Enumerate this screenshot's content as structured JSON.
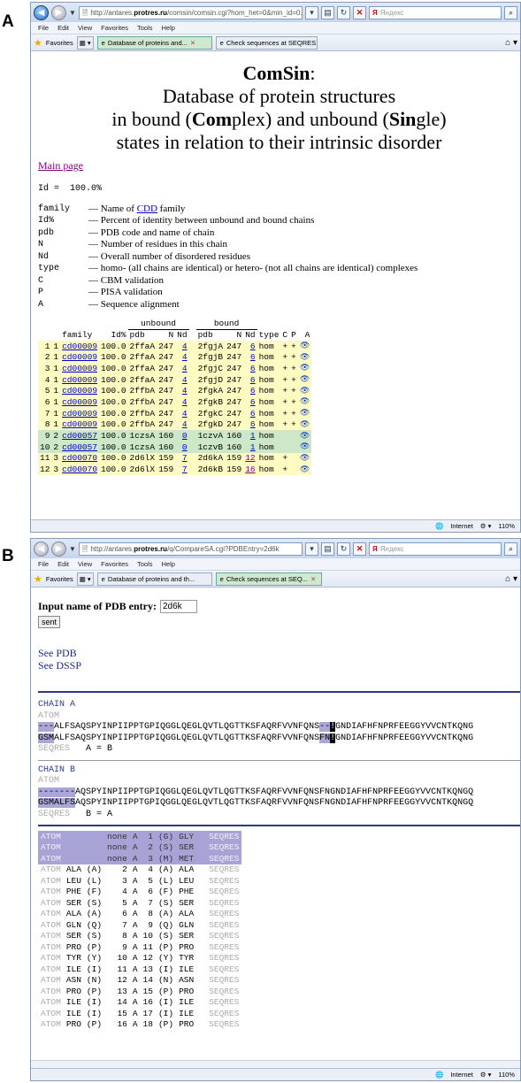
{
  "panelA": {
    "letter": "A",
    "browser": {
      "url_prefix": "http://antares.",
      "url_domain": "protres.ru",
      "url_suffix": "/comsin/comsin.cgi?hom_het=0&min_id=0.9",
      "search_engine": "Яндекс",
      "menu": [
        "File",
        "Edit",
        "View",
        "Favorites",
        "Tools",
        "Help"
      ],
      "favorites_label": "Favorites",
      "tabs": [
        "Database of proteins and...",
        "Check sequences at SEQRES..."
      ],
      "status_zone": "Internet",
      "zoom": "110%"
    },
    "page": {
      "title_word": "ComSin",
      "title_colon": ":",
      "subtitle1": "Database of protein structures",
      "subtitle2_a": "in bound (",
      "subtitle2_com": "Com",
      "subtitle2_b": "plex) and unbound (",
      "subtitle2_sin": "Sin",
      "subtitle2_c": "gle)",
      "subtitle3": "states in relation to their intrinsic disorder",
      "main_page_link": "Main page",
      "id_line": "Id =  100.0%",
      "legend": [
        {
          "key": "family",
          "pre": "— Name of ",
          "link": "CDD",
          "post": " family"
        },
        {
          "key": "Id%",
          "pre": "— Percent of identity between unbound and bound chains",
          "link": "",
          "post": ""
        },
        {
          "key": "pdb",
          "pre": "— PDB code and name of chain",
          "link": "",
          "post": ""
        },
        {
          "key": "N",
          "pre": "— Number of residues in this chain",
          "link": "",
          "post": ""
        },
        {
          "key": "Nd",
          "pre": "— Overall number of disordered residues",
          "link": "",
          "post": ""
        },
        {
          "key": "type",
          "pre": "— homo- (all chains are identical) or hetero- (not all chains are identical) complexes",
          "link": "",
          "post": ""
        },
        {
          "key": "C",
          "pre": "— CBM validation",
          "link": "",
          "post": ""
        },
        {
          "key": "P",
          "pre": "— PISA validation",
          "link": "",
          "post": ""
        },
        {
          "key": "A",
          "pre": "— Sequence alignment",
          "link": "",
          "post": ""
        }
      ],
      "table_group_unbound": "unbound",
      "table_group_bound": "bound",
      "table_headers": [
        "",
        "",
        "family",
        "Id%",
        "pdb",
        "N",
        "Nd",
        "pdb",
        "N",
        "Nd",
        "type",
        "C",
        "P",
        "A"
      ],
      "rows": [
        {
          "n": "1",
          "g": "1",
          "family": "cd00009",
          "id": "100.0",
          "pdb_u": "2ffaA",
          "n_u": "247",
          "nd_u": "4",
          "pdb_b": "2fgjA",
          "n_b": "247",
          "nd_b": "6",
          "type": "hom",
          "c": "+",
          "p": "+",
          "color": "yellow"
        },
        {
          "n": "2",
          "g": "1",
          "family": "cd00009",
          "id": "100.0",
          "pdb_u": "2ffaA",
          "n_u": "247",
          "nd_u": "4",
          "pdb_b": "2fgjB",
          "n_b": "247",
          "nd_b": "6",
          "type": "hom",
          "c": "+",
          "p": "+",
          "color": "yellow"
        },
        {
          "n": "3",
          "g": "1",
          "family": "cd00009",
          "id": "100.0",
          "pdb_u": "2ffaA",
          "n_u": "247",
          "nd_u": "4",
          "pdb_b": "2fgjC",
          "n_b": "247",
          "nd_b": "6",
          "type": "hom",
          "c": "+",
          "p": "+",
          "color": "yellow"
        },
        {
          "n": "4",
          "g": "1",
          "family": "cd00009",
          "id": "100.0",
          "pdb_u": "2ffaA",
          "n_u": "247",
          "nd_u": "4",
          "pdb_b": "2fgjD",
          "n_b": "247",
          "nd_b": "6",
          "type": "hom",
          "c": "+",
          "p": "+",
          "color": "yellow"
        },
        {
          "n": "5",
          "g": "1",
          "family": "cd00009",
          "id": "100.0",
          "pdb_u": "2ffbA",
          "n_u": "247",
          "nd_u": "4",
          "pdb_b": "2fgkA",
          "n_b": "247",
          "nd_b": "6",
          "type": "hom",
          "c": "+",
          "p": "+",
          "color": "yellow"
        },
        {
          "n": "6",
          "g": "1",
          "family": "cd00009",
          "id": "100.0",
          "pdb_u": "2ffbA",
          "n_u": "247",
          "nd_u": "4",
          "pdb_b": "2fgkB",
          "n_b": "247",
          "nd_b": "6",
          "type": "hom",
          "c": "+",
          "p": "+",
          "color": "yellow"
        },
        {
          "n": "7",
          "g": "1",
          "family": "cd00009",
          "id": "100.0",
          "pdb_u": "2ffbA",
          "n_u": "247",
          "nd_u": "4",
          "pdb_b": "2fgkC",
          "n_b": "247",
          "nd_b": "6",
          "type": "hom",
          "c": "+",
          "p": "+",
          "color": "yellow"
        },
        {
          "n": "8",
          "g": "1",
          "family": "cd00009",
          "id": "100.0",
          "pdb_u": "2ffbA",
          "n_u": "247",
          "nd_u": "4",
          "pdb_b": "2fgkD",
          "n_b": "247",
          "nd_b": "6",
          "type": "hom",
          "c": "+",
          "p": "+",
          "color": "yellow"
        },
        {
          "n": "9",
          "g": "2",
          "family": "cd00057",
          "id": "100.0",
          "pdb_u": "1czsA",
          "n_u": "160",
          "nd_u": "0",
          "pdb_b": "1czvA",
          "n_b": "160",
          "nd_b": "1",
          "type": "hom",
          "c": "",
          "p": "",
          "color": "green"
        },
        {
          "n": "10",
          "g": "2",
          "family": "cd00057",
          "id": "100.0",
          "pdb_u": "1czsA",
          "n_u": "160",
          "nd_u": "0",
          "pdb_b": "1czvB",
          "n_b": "160",
          "nd_b": "1",
          "type": "hom",
          "c": "",
          "p": "",
          "color": "green"
        },
        {
          "n": "11",
          "g": "3",
          "family": "cd00070",
          "id": "100.0",
          "pdb_u": "2d6lX",
          "n_u": "159",
          "nd_u": "7",
          "pdb_b": "2d6kA",
          "n_b": "159",
          "nd_b": "12",
          "type": "hom",
          "c": "+",
          "p": "",
          "color": "yellow"
        },
        {
          "n": "12",
          "g": "3",
          "family": "cd00070",
          "id": "100.0",
          "pdb_u": "2d6lX",
          "n_u": "159",
          "nd_u": "7",
          "pdb_b": "2d6kB",
          "n_b": "159",
          "nd_b": "16",
          "type": "hom",
          "c": "+",
          "p": "",
          "color": "yellow"
        }
      ]
    }
  },
  "panelB": {
    "letter": "B",
    "browser": {
      "url_prefix": "http://antares.",
      "url_domain": "protres.ru",
      "url_suffix": "/q/CompareSA.cgi?PDBEntry=2d6k",
      "search_engine": "Яндекс",
      "menu": [
        "File",
        "Edit",
        "View",
        "Favorites",
        "Tools",
        "Help"
      ],
      "favorites_label": "Favorites",
      "tabs": [
        "Database of proteins and th...",
        "Check sequences at SEQ..."
      ],
      "status_zone": "Internet",
      "zoom": "110%"
    },
    "page": {
      "input_label": "Input name of PDB entry:",
      "input_value": "2d6k",
      "sent_button": "sent",
      "see_pdb": "See PDB",
      "see_dssp": "See DSSP",
      "chain_a": {
        "title": "CHAIN A",
        "atom_label": "ATOM",
        "atom_hl": "---",
        "atom_seq1": "ALFSAQSPYINPIIPPTGPIQGGLQEGLQVTLQGTTKSFAQRFVVNFQNS",
        "atom_hl2": "--",
        "atom_blk": "!",
        "atom_seq2": "GNDIAFHFNPRFEEGGYVVCNTKQNG",
        "seqres_hl": "GSM",
        "seqres_seq1": "ALFSAQSPYINPIIPPTGPIQGGLQEGLQVTLQGTTKSFAQRFVVNFQNS",
        "seqres_hl2": "FN",
        "seqres_blk": "!",
        "seqres_seq2": "GNDIAFHFNPRFEEGGYVVCNTKQNG",
        "seqres_label": "SEQRES",
        "relation": "A = B"
      },
      "chain_b": {
        "title": "CHAIN B",
        "atom_label": "ATOM",
        "atom_hl": "-------",
        "atom_seq": "AQSPYINPIIPPTGPIQGGLQEGLQVTLQGTTKSFAQRFVVNFQNSFNGNDIAFHFNPRFEEGGYVVCNTKQNGQ",
        "seqres_hl": "GSMALFS",
        "seqres_seq": "AQSPYINPIIPPTGPIQGGLQEGLQVTLQGTTKSFAQRFVVNFQNSFNGNDIAFHFNPRFEEGGYVVCNTKQNGQ",
        "seqres_label": "SEQRES",
        "relation": "B = A"
      },
      "residue_rows": [
        [
          "ATOM",
          "",
          "",
          "none",
          "A",
          "1",
          "(G)",
          "GLY",
          "SEQRES",
          "hdr"
        ],
        [
          "ATOM",
          "",
          "",
          "none",
          "A",
          "2",
          "(S)",
          "SER",
          "SEQRES",
          "hdr"
        ],
        [
          "ATOM",
          "",
          "",
          "none",
          "A",
          "3",
          "(M)",
          "MET",
          "SEQRES",
          "hdr"
        ],
        [
          "ATOM",
          "ALA",
          "(A)",
          "2",
          "A",
          "4",
          "(A)",
          "ALA",
          "SEQRES",
          ""
        ],
        [
          "ATOM",
          "LEU",
          "(L)",
          "3",
          "A",
          "5",
          "(L)",
          "LEU",
          "SEQRES",
          ""
        ],
        [
          "ATOM",
          "PHE",
          "(F)",
          "4",
          "A",
          "6",
          "(F)",
          "PHE",
          "SEQRES",
          ""
        ],
        [
          "ATOM",
          "SER",
          "(S)",
          "5",
          "A",
          "7",
          "(S)",
          "SER",
          "SEQRES",
          ""
        ],
        [
          "ATOM",
          "ALA",
          "(A)",
          "6",
          "A",
          "8",
          "(A)",
          "ALA",
          "SEQRES",
          ""
        ],
        [
          "ATOM",
          "GLN",
          "(Q)",
          "7",
          "A",
          "9",
          "(Q)",
          "GLN",
          "SEQRES",
          ""
        ],
        [
          "ATOM",
          "SER",
          "(S)",
          "8",
          "A",
          "10",
          "(S)",
          "SER",
          "SEQRES",
          ""
        ],
        [
          "ATOM",
          "PRO",
          "(P)",
          "9",
          "A",
          "11",
          "(P)",
          "PRO",
          "SEQRES",
          ""
        ],
        [
          "ATOM",
          "TYR",
          "(Y)",
          "10",
          "A",
          "12",
          "(Y)",
          "TYR",
          "SEQRES",
          ""
        ],
        [
          "ATOM",
          "ILE",
          "(I)",
          "11",
          "A",
          "13",
          "(I)",
          "ILE",
          "SEQRES",
          ""
        ],
        [
          "ATOM",
          "ASN",
          "(N)",
          "12",
          "A",
          "14",
          "(N)",
          "ASN",
          "SEQRES",
          ""
        ],
        [
          "ATOM",
          "PRO",
          "(P)",
          "13",
          "A",
          "15",
          "(P)",
          "PRO",
          "SEQRES",
          ""
        ],
        [
          "ATOM",
          "ILE",
          "(I)",
          "14",
          "A",
          "16",
          "(I)",
          "ILE",
          "SEQRES",
          ""
        ],
        [
          "ATOM",
          "ILE",
          "(I)",
          "15",
          "A",
          "17",
          "(I)",
          "ILE",
          "SEQRES",
          ""
        ],
        [
          "ATOM",
          "PRO",
          "(P)",
          "16",
          "A",
          "18",
          "(P)",
          "PRO",
          "SEQRES",
          ""
        ]
      ]
    }
  },
  "colors": {
    "yellow_row": "#fefbc2",
    "green_row": "#cde8c6",
    "link": "#0000cc",
    "highlight": "#a9a6d8",
    "navy_rule": "#2f3a86"
  }
}
